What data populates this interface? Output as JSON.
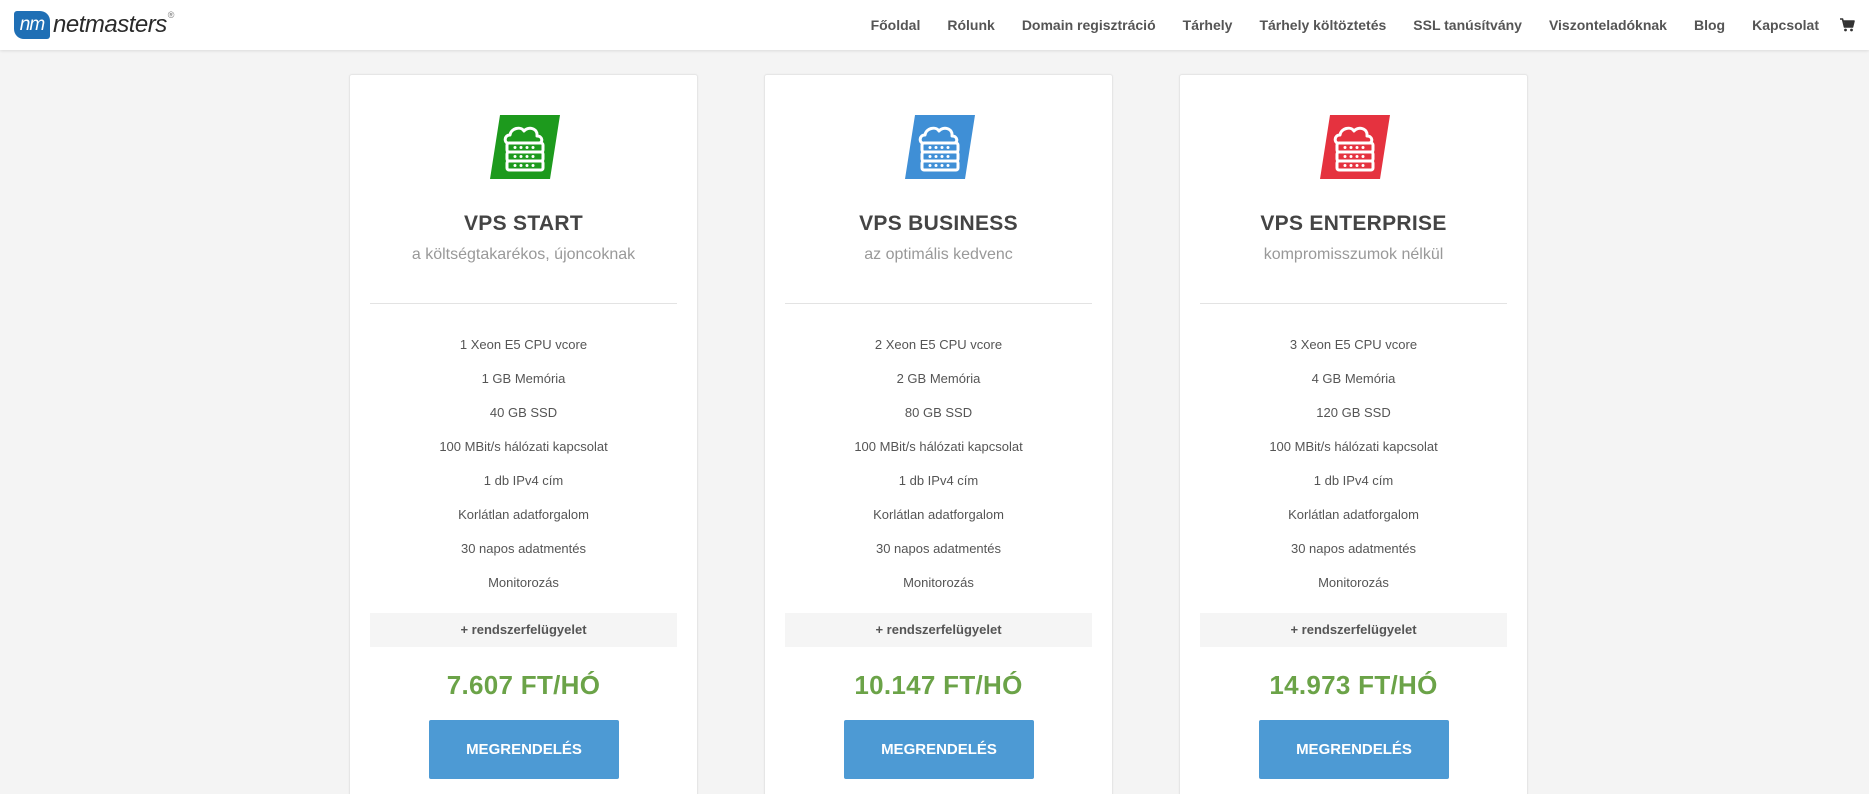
{
  "header": {
    "logo_badge": "nm",
    "logo_text": "netmasters",
    "logo_reg": "®",
    "nav": [
      "Főoldal",
      "Rólunk",
      "Domain regisztráció",
      "Tárhely",
      "Tárhely költöztetés",
      "SSL tanúsítvány",
      "Viszonteladóknak",
      "Blog",
      "Kapcsolat"
    ],
    "cart_icon": "cart-icon"
  },
  "plans": [
    {
      "icon": "cloud-server-icon",
      "color": "#1d9a1d",
      "title": "VPS START",
      "subtitle": "a költségtakarékos, újoncoknak",
      "features": [
        "1 Xeon E5 CPU vcore",
        "1 GB Memória",
        "40 GB SSD",
        "100 MBit/s hálózati kapcsolat",
        "1 db IPv4 cím",
        "Korlátlan adatforgalom",
        "30 napos adatmentés",
        "Monitorozás"
      ],
      "extra": "+ rendszerfelügyelet",
      "price": "7.607 FT/HÓ",
      "button": "MEGRENDELÉS"
    },
    {
      "icon": "cloud-server-icon",
      "color": "#3f8fd6",
      "title": "VPS BUSINESS",
      "subtitle": "az optimális kedvenc",
      "features": [
        "2 Xeon E5 CPU vcore",
        "2 GB Memória",
        "80 GB SSD",
        "100 MBit/s hálózati kapcsolat",
        "1 db IPv4 cím",
        "Korlátlan adatforgalom",
        "30 napos adatmentés",
        "Monitorozás"
      ],
      "extra": "+ rendszerfelügyelet",
      "price": "10.147 FT/HÓ",
      "button": "MEGRENDELÉS"
    },
    {
      "icon": "cloud-server-icon",
      "color": "#e5323f",
      "title": "VPS ENTERPRISE",
      "subtitle": "kompromisszumok nélkül",
      "features": [
        "3 Xeon E5 CPU vcore",
        "4 GB Memória",
        "120 GB SSD",
        "100 MBit/s hálózati kapcsolat",
        "1 db IPv4 cím",
        "Korlátlan adatforgalom",
        "30 napos adatmentés",
        "Monitorozás"
      ],
      "extra": "+ rendszerfelügyelet",
      "price": "14.973 FT/HÓ",
      "button": "MEGRENDELÉS"
    }
  ]
}
